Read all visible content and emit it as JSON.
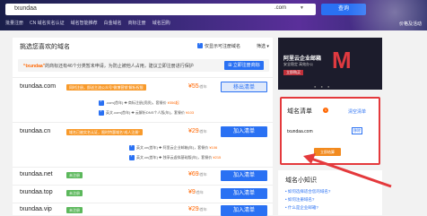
{
  "search": {
    "value": "txundaa",
    "tld": ".com",
    "button": "查询"
  },
  "nav": [
    "批量注册",
    "CN 域名实名认证",
    "域名智能推荐",
    "白金域名",
    "商标注册",
    "域名回购"
  ],
  "price_link": "价格及活动",
  "main": {
    "title": "挑选您喜欢的域名",
    "only_available": "仅显示可注册域名",
    "filter": "筛选",
    "banner_text_prefix": "“txundaa”",
    "banner_text_rest": "的商标还有46个分类暂未申请，为防止被他人占用，建议立即注册进行保护",
    "banner_count": "46个分类",
    "banner_button": "立即注册商标"
  },
  "domains": [
    {
      "name": "txundaa.com",
      "tag": "同时注册，即送主流公众号“微博营销”解析权限",
      "tag_color": "orange",
      "price": "¥55",
      "unit": "/首年",
      "button": "移出清单",
      "button_state": "added",
      "extras": [
        {
          "text": ".com(首年)",
          "plus": "商标注册(资质)，套餐价",
          "price": "¥356起"
        },
        {
          "text": "英文.com(首年)",
          "plus": "云解析DNS个人版(年)，套餐价",
          "price": "¥103"
        }
      ]
    },
    {
      "name": "txundaa.cn",
      "tag": "域名已被实名认证，限时特惠域名“成人注册”",
      "tag_color": "orange",
      "price": "¥29",
      "unit": "/首年",
      "button": "加入清单",
      "button_state": "default",
      "extras": [
        {
          "text": "英文.cn(首年)",
          "plus": "阿里云企业邮箱(年)，套餐价",
          "price": "¥106"
        },
        {
          "text": "英文.cn(首年)",
          "plus": "独享云虚拟基础版(年)，套餐价",
          "price": "¥215"
        }
      ]
    },
    {
      "name": "txundaa.net",
      "tag": "未注册",
      "tag_color": "green",
      "price": "¥69",
      "unit": "/首年",
      "button": "加入清单",
      "button_state": "default",
      "extras": []
    },
    {
      "name": "txundaa.top",
      "tag": "未注册",
      "tag_color": "green",
      "price": "¥9",
      "unit": "/首年",
      "button": "加入清单",
      "button_state": "default",
      "extras": []
    },
    {
      "name": "txundaa.vip",
      "tag": "未注册",
      "tag_color": "green",
      "price": "¥29",
      "unit": "/首年",
      "button": "加入清单",
      "button_state": "default",
      "extras": []
    }
  ],
  "ad": {
    "title": "阿里云企业邮箱",
    "subtitle": "安全稳定 高效办公",
    "button": "立即购买",
    "logo": "M"
  },
  "cart": {
    "title": "域名清单",
    "count": "1",
    "clear": "清空清单",
    "domain": "txundaa.com",
    "remove": "移除",
    "checkout": "立即结算"
  },
  "knowledge": {
    "title": "域名小知识",
    "links": [
      "如何选择适合您的域名?",
      "如何注册域名?",
      "什么是企业邮箱?"
    ]
  },
  "colors": {
    "primary": "#2a71f3",
    "price": "#ff6600",
    "highlight": "#e4393c"
  }
}
